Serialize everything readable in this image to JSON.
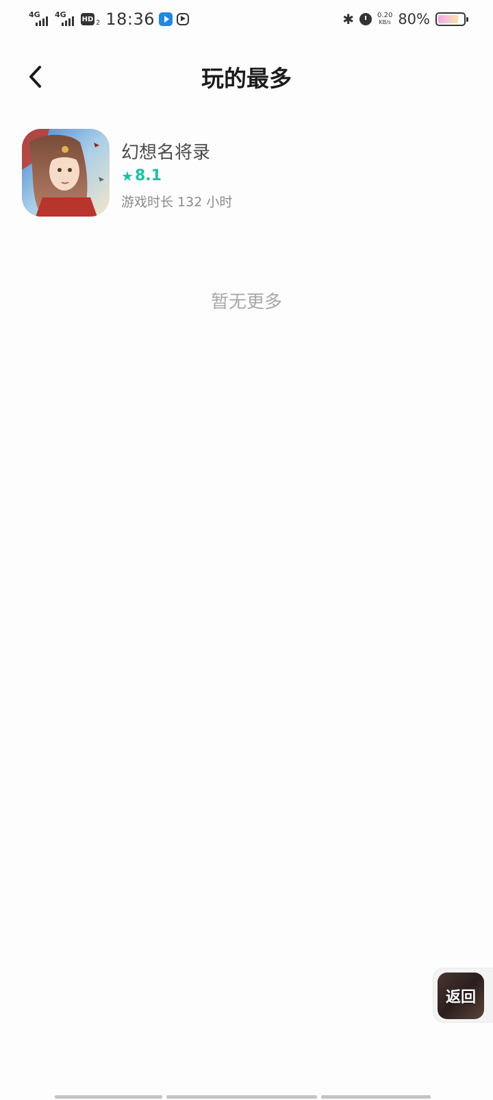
{
  "status_bar": {
    "network1": "4G",
    "network2": "4G",
    "hd": "HD",
    "hd_sub": "2",
    "time": "18:36",
    "speed_value": "0.20",
    "speed_unit": "KB/s",
    "battery_percent": "80%",
    "battery_level": 0.8,
    "icons": [
      "signal-icon",
      "hd-icon",
      "app-notification-icon",
      "media-icon",
      "bluetooth-icon",
      "alarm-icon",
      "battery-icon"
    ]
  },
  "header": {
    "title": "玩的最多",
    "back_icon": "chevron-left-icon"
  },
  "games": [
    {
      "name": "幻想名将录",
      "rating": "8.1",
      "playtime": "游戏时长 132 小时"
    }
  ],
  "list_end_text": "暂无更多",
  "floating_button": {
    "label": "返回"
  },
  "colors": {
    "accent": "#18c2a4",
    "title": "#1b1b1b",
    "subtext": "#8a8a8a"
  }
}
